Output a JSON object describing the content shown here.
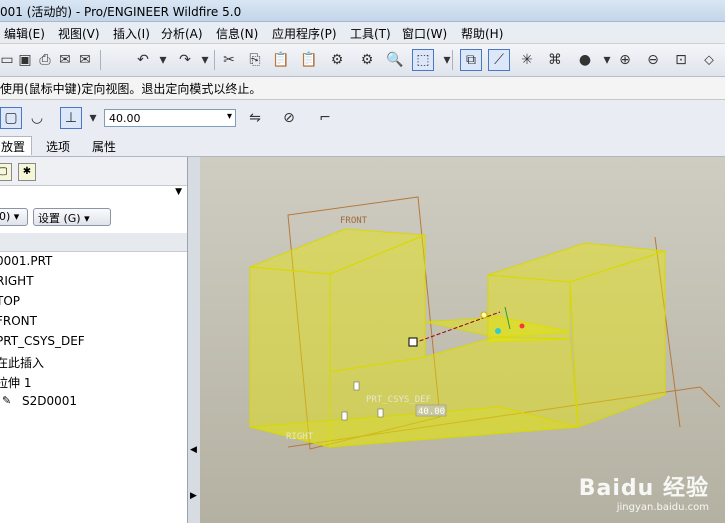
{
  "window": {
    "title": "001 (活动的) - Pro/ENGINEER Wildfire 5.0"
  },
  "menu": {
    "items": [
      "编辑(E)",
      "视图(V)",
      "插入(I)",
      "分析(A)",
      "信息(N)",
      "应用程序(P)",
      "工具(T)",
      "窗口(W)",
      "帮助(H)"
    ]
  },
  "message": {
    "text": "使用(鼠标中键)定向视图。退出定向模式以终止。"
  },
  "dashboard": {
    "depth_value": "40.00"
  },
  "tabs": [
    "放置",
    "选项",
    "属性"
  ],
  "left_panel": {
    "buttons": {
      "show": "0) ▾",
      "settings": "设置 (G) ▾"
    },
    "tree": [
      "0001.PRT",
      "RIGHT",
      "TOP",
      "FRONT",
      "PRT_CSYS_DEF",
      "在此插入",
      "拉伸 1",
      "S2D0001"
    ]
  },
  "viewport": {
    "labels": {
      "front": "FRONT",
      "csys": "PRT_CSYS_DEF",
      "dim": "40.00",
      "right": "RIGHT"
    },
    "accent": "#e6e600"
  },
  "watermark": {
    "brand": "Baidu 经验",
    "url": "jingyan.baidu.com"
  }
}
